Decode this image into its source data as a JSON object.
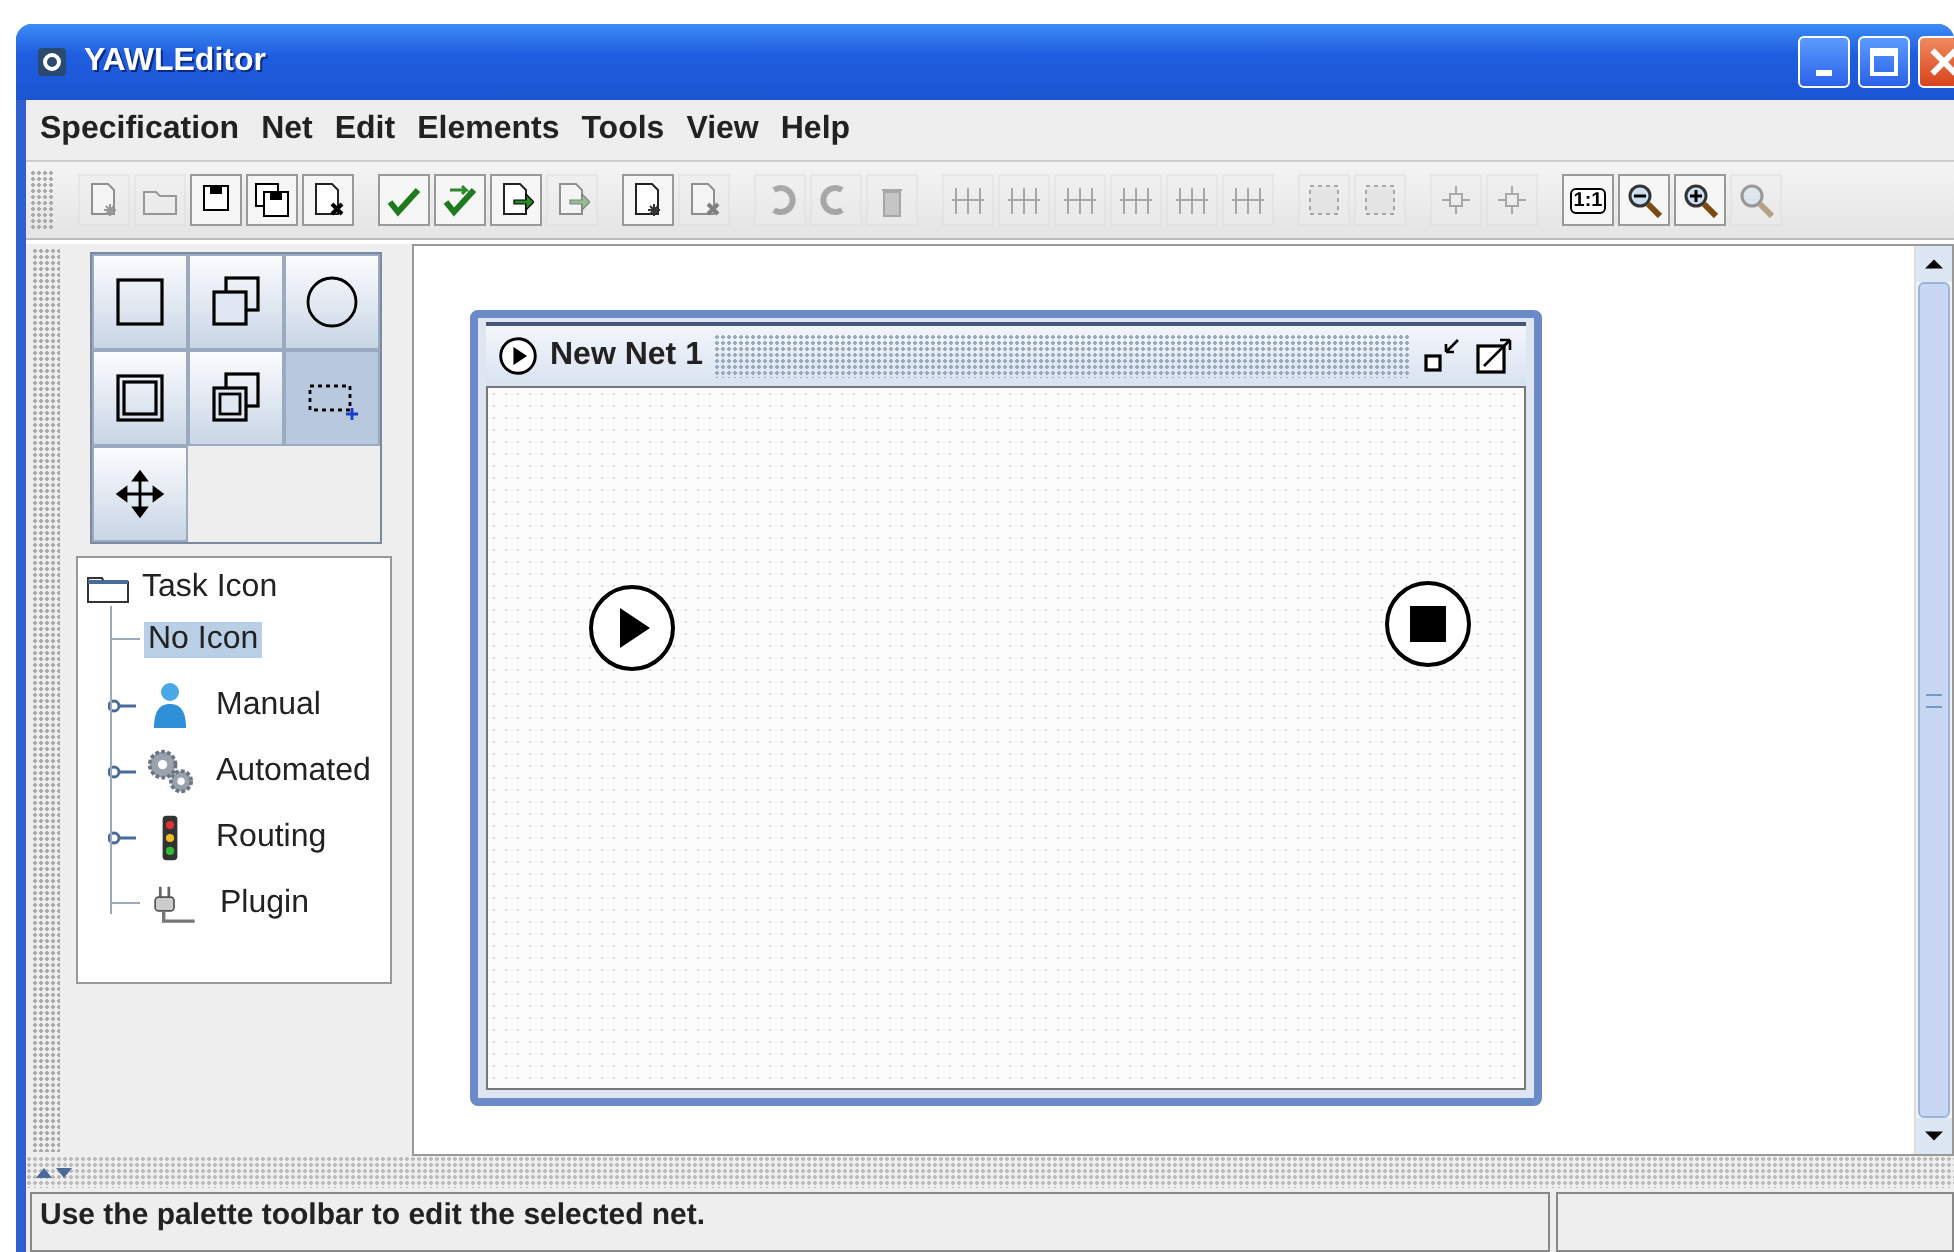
{
  "window": {
    "title": "YAWLEditor"
  },
  "menu": [
    {
      "label": "Specification"
    },
    {
      "label": "Net"
    },
    {
      "label": "Edit"
    },
    {
      "label": "Elements"
    },
    {
      "label": "Tools"
    },
    {
      "label": "View"
    },
    {
      "label": "Help"
    }
  ],
  "toolbar": [
    [
      {
        "kind": "doc-new",
        "enabled": false
      },
      {
        "kind": "folder",
        "enabled": false
      },
      {
        "kind": "disk",
        "enabled": true
      },
      {
        "kind": "disks",
        "enabled": true
      },
      {
        "kind": "doc-close",
        "enabled": true
      }
    ],
    [
      {
        "kind": "check",
        "enabled": true
      },
      {
        "kind": "check-double",
        "enabled": true
      },
      {
        "kind": "doc-export",
        "enabled": true
      },
      {
        "kind": "doc-import",
        "enabled": false
      }
    ],
    [
      {
        "kind": "net-add",
        "enabled": true
      },
      {
        "kind": "net-remove",
        "enabled": false
      }
    ],
    [
      {
        "kind": "undo",
        "enabled": false
      },
      {
        "kind": "redo",
        "enabled": false
      },
      {
        "kind": "trash",
        "enabled": false
      }
    ],
    [
      {
        "kind": "align",
        "enabled": false
      },
      {
        "kind": "align",
        "enabled": false
      },
      {
        "kind": "align",
        "enabled": false
      },
      {
        "kind": "align",
        "enabled": false
      },
      {
        "kind": "align",
        "enabled": false
      },
      {
        "kind": "align",
        "enabled": false
      }
    ],
    [
      {
        "kind": "group",
        "enabled": false
      },
      {
        "kind": "group",
        "enabled": false
      }
    ],
    [
      {
        "kind": "node",
        "enabled": false
      },
      {
        "kind": "node",
        "enabled": false
      }
    ],
    [
      {
        "kind": "text",
        "label": "1:1",
        "enabled": true
      },
      {
        "kind": "zoom-out",
        "enabled": true
      },
      {
        "kind": "zoom-in",
        "enabled": true
      },
      {
        "kind": "zoom",
        "enabled": false
      }
    ]
  ],
  "palette": [
    {
      "kind": "task",
      "selected": false
    },
    {
      "kind": "multi-task",
      "selected": false
    },
    {
      "kind": "condition",
      "selected": false
    },
    {
      "kind": "composite-task",
      "selected": false
    },
    {
      "kind": "multi-composite",
      "selected": false
    },
    {
      "kind": "marquee",
      "selected": true
    },
    {
      "kind": "move",
      "selected": false
    }
  ],
  "task_icon_tree": {
    "label": "Task Icon",
    "expanded": true,
    "children": [
      {
        "label": "No Icon",
        "kind": "none",
        "selected": true
      },
      {
        "label": "Manual",
        "kind": "person",
        "selected": false,
        "expanded": false
      },
      {
        "label": "Automated",
        "kind": "gears",
        "selected": false,
        "expanded": false
      },
      {
        "label": "Routing",
        "kind": "traffic-light",
        "selected": false,
        "expanded": false
      },
      {
        "label": "Plugin",
        "kind": "plug",
        "selected": false
      }
    ]
  },
  "net": {
    "title": "New Net 1",
    "elements": [
      {
        "kind": "input-condition"
      },
      {
        "kind": "output-condition"
      }
    ]
  },
  "status_bar": {
    "message": "Use the palette toolbar to edit the selected net."
  }
}
